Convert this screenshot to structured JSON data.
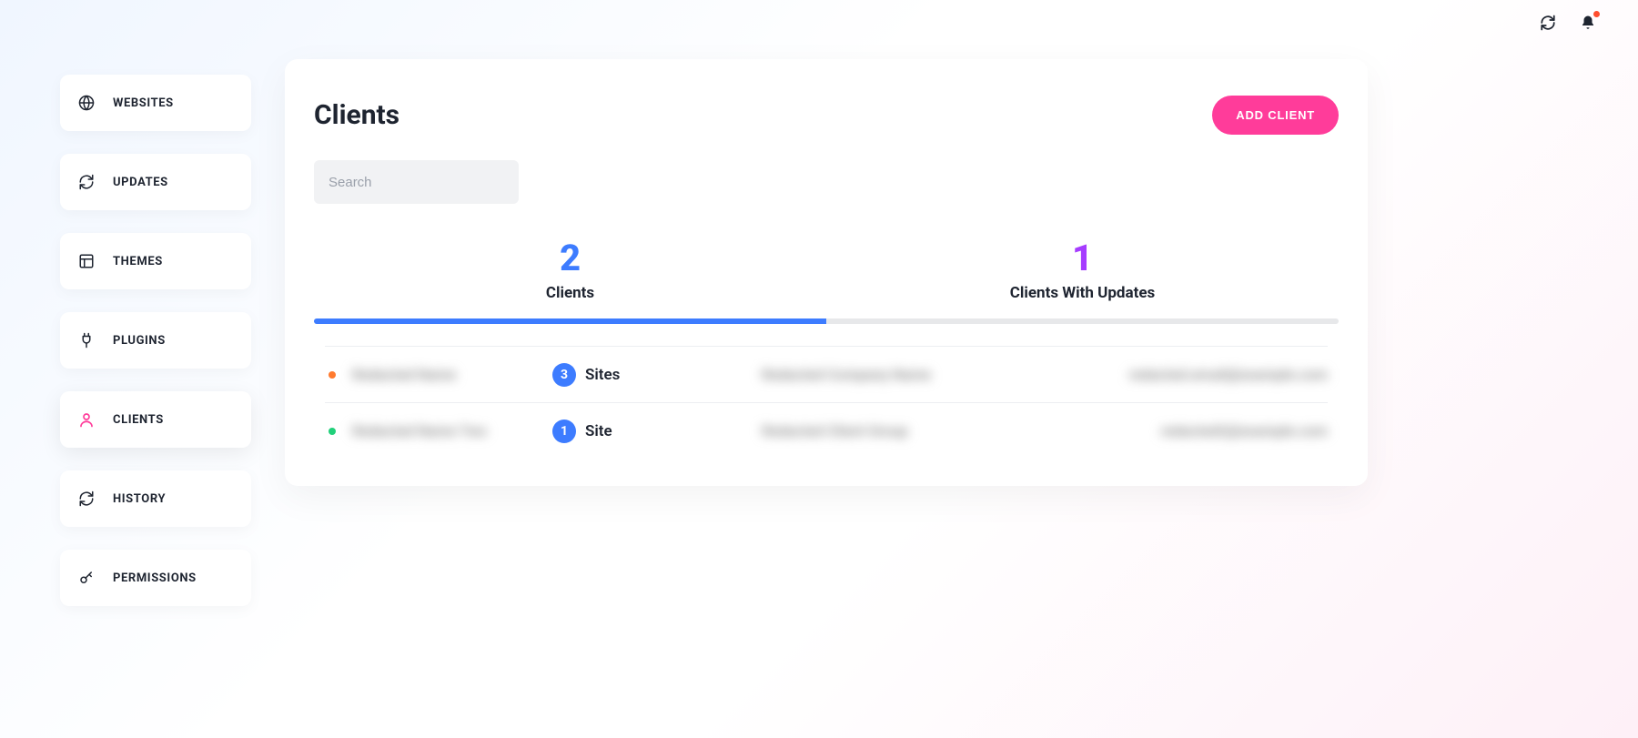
{
  "sidebar": {
    "items": [
      {
        "label": "WEBSITES"
      },
      {
        "label": "UPDATES"
      },
      {
        "label": "THEMES"
      },
      {
        "label": "PLUGINS"
      },
      {
        "label": "CLIENTS"
      },
      {
        "label": "HISTORY"
      },
      {
        "label": "PERMISSIONS"
      }
    ]
  },
  "header": {
    "title": "Clients",
    "add_button": "ADD CLIENT"
  },
  "search": {
    "placeholder": "Search"
  },
  "tabs": {
    "clients": {
      "count": "2",
      "label": "Clients"
    },
    "with_updates": {
      "count": "1",
      "label": "Clients With Updates"
    }
  },
  "rows": [
    {
      "status": "orange",
      "name": "Redacted Name",
      "site_count": "3",
      "site_word": "Sites",
      "company": "Redacted Company Name",
      "email": "redacted.email@example.com"
    },
    {
      "status": "green",
      "name": "Redacted Name Two",
      "site_count": "1",
      "site_word": "Site",
      "company": "Redacted Client Group",
      "email": "redacted2@example.com"
    }
  ]
}
